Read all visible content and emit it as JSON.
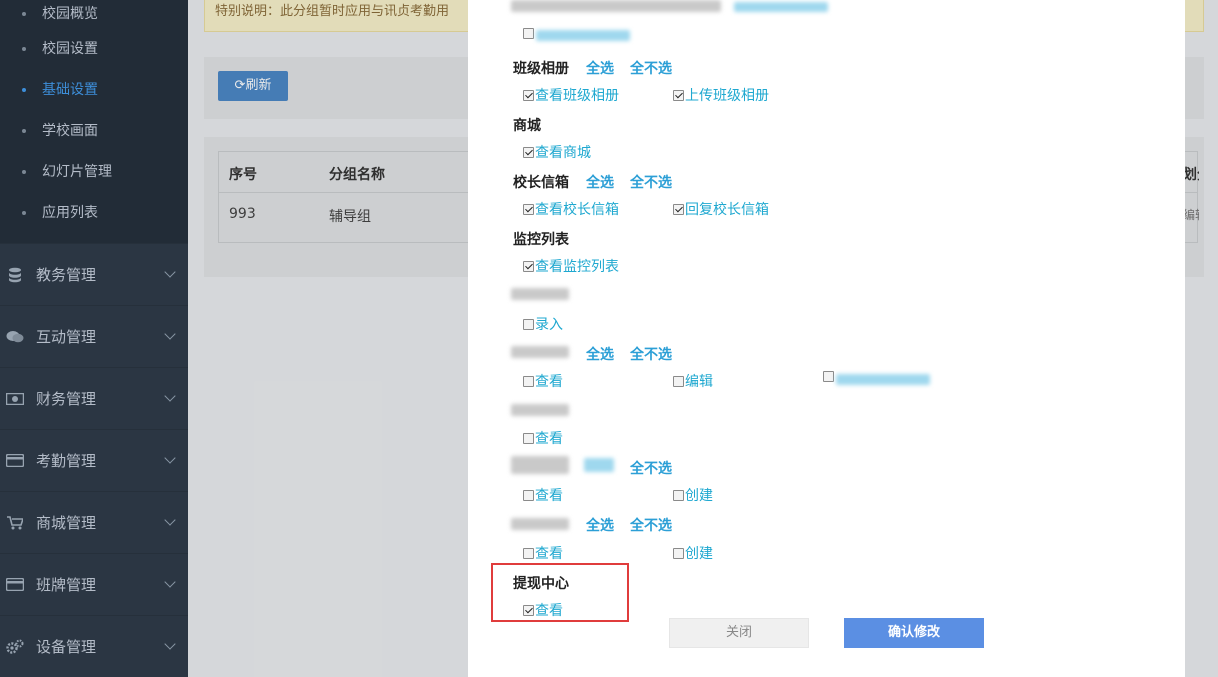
{
  "sidebar": {
    "sub_items": [
      {
        "label": "校园概览",
        "active": false
      },
      {
        "label": "校园设置",
        "active": false
      },
      {
        "label": "基础设置",
        "active": true
      },
      {
        "label": "学校画面",
        "active": false
      },
      {
        "label": "幻灯片管理",
        "active": false
      },
      {
        "label": "应用列表",
        "active": false
      }
    ],
    "menus": [
      {
        "label": "教务管理",
        "icon": "database-icon"
      },
      {
        "label": "互动管理",
        "icon": "chat-icon"
      },
      {
        "label": "财务管理",
        "icon": "money-icon"
      },
      {
        "label": "考勤管理",
        "icon": "card-icon"
      },
      {
        "label": "商城管理",
        "icon": "cart-icon"
      },
      {
        "label": "班牌管理",
        "icon": "card-icon"
      },
      {
        "label": "设备管理",
        "icon": "gears-icon"
      }
    ]
  },
  "background": {
    "notice": "特别说明：此分组暂时应用与讯贞考勤用",
    "refresh_label": "⟳刷新",
    "table": {
      "headers": [
        "序号",
        "分组名称",
        "划分象"
      ],
      "row": [
        "993",
        "辅导组",
        "编辑"
      ]
    }
  },
  "modal": {
    "groups": {
      "album_title": "班级相册",
      "select_all": "全选",
      "select_none": "全不选",
      "album_view": "查看班级相册",
      "album_upload": "上传班级相册",
      "mall_title": "商城",
      "mall_view": "查看商城",
      "mailbox_title": "校长信箱",
      "mailbox_view": "查看校长信箱",
      "mailbox_reply": "回复校长信箱",
      "monitor_title": "监控列表",
      "monitor_view": "查看监控列表",
      "entry_label": "录入",
      "view": "查看",
      "edit": "编辑",
      "create": "创建",
      "withdraw_title": "提现中心",
      "withdraw_view": "查看"
    },
    "buttons": {
      "close": "关闭",
      "confirm": "确认修改"
    }
  }
}
